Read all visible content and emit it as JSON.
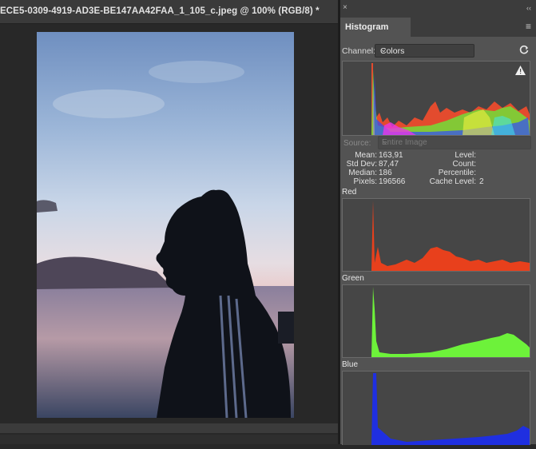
{
  "document": {
    "tab_title": "ECE5-0309-4919-AD3E-BE147AA42FAA_1_105_c.jpeg @ 100% (RGB/8) *"
  },
  "panel": {
    "close_glyph": "×",
    "collapse_glyph": "‹‹",
    "tab_label": "Histogram",
    "menu_glyph": "≡",
    "channel_label": "Channel:",
    "channel_value": "Colors",
    "source_label": "Source:",
    "source_value": "Entire Image",
    "stats": {
      "mean_label": "Mean:",
      "mean_value": "163,91",
      "stddev_label": "Std Dev:",
      "stddev_value": "87,47",
      "median_label": "Median:",
      "median_value": "186",
      "pixels_label": "Pixels:",
      "pixels_value": "196566",
      "level_label": "Level:",
      "count_label": "Count:",
      "percentile_label": "Percentile:",
      "cache_label": "Cache Level:",
      "cache_value": "2"
    },
    "channels": [
      {
        "name": "Red",
        "color": "#e8401c"
      },
      {
        "name": "Green",
        "color": "#6df23a"
      },
      {
        "name": "Blue",
        "color": "#1f2fe0"
      }
    ]
  },
  "icons": {
    "refresh": "refresh-icon",
    "warning": "warning-icon",
    "chevron": "chevron-down-icon"
  }
}
